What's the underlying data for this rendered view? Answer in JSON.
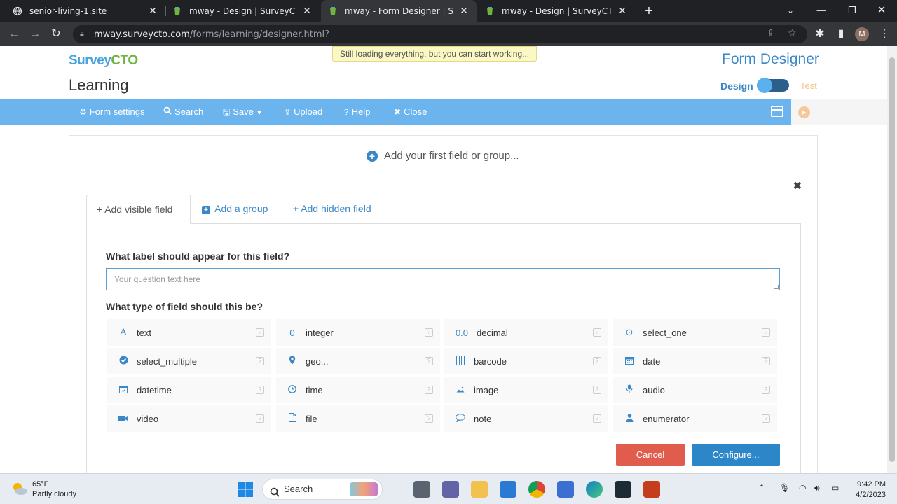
{
  "browser": {
    "tabs": [
      {
        "title": "senior-living-1.site",
        "active": false
      },
      {
        "title": "mway - Design | SurveyCTO",
        "active": false
      },
      {
        "title": "mway - Form Designer | SurveyC",
        "active": true
      },
      {
        "title": "mway - Design | SurveyCTO",
        "active": false
      }
    ],
    "url_host": "mway.surveycto.com",
    "url_path": "/forms/learning/designer.html?",
    "profile_initial": "M"
  },
  "app": {
    "logo_survey": "Survey",
    "logo_cto": "CTO",
    "form_name": "Learning",
    "loading_notice": "Still loading everything, but you can start working...",
    "page_title": "Form Designer",
    "mode_design": "Design",
    "mode_test": "Test",
    "mode_design_active": true
  },
  "toolbar": {
    "form_settings": "Form settings",
    "search": "Search",
    "save": "Save",
    "upload": "Upload",
    "help": "Help",
    "close": "Close"
  },
  "editor": {
    "add_first": "Add your first field or group...",
    "tabs": {
      "visible": "Add visible field",
      "group": "Add a group",
      "hidden": "Add hidden field"
    },
    "label_question": "What label should appear for this field?",
    "label_placeholder": "Your question text here",
    "type_question": "What type of field should this be?",
    "field_types": [
      {
        "name": "text",
        "icon": "text-icon"
      },
      {
        "name": "integer",
        "icon": "integer-icon"
      },
      {
        "name": "decimal",
        "icon": "decimal-icon"
      },
      {
        "name": "select_one",
        "icon": "radio-icon"
      },
      {
        "name": "select_multiple",
        "icon": "check-circle-icon"
      },
      {
        "name": "geo...",
        "icon": "map-marker-icon"
      },
      {
        "name": "barcode",
        "icon": "barcode-icon"
      },
      {
        "name": "date",
        "icon": "calendar-icon"
      },
      {
        "name": "datetime",
        "icon": "calendar-clock-icon"
      },
      {
        "name": "time",
        "icon": "clock-icon"
      },
      {
        "name": "image",
        "icon": "image-icon"
      },
      {
        "name": "audio",
        "icon": "microphone-icon"
      },
      {
        "name": "video",
        "icon": "video-camera-icon"
      },
      {
        "name": "file",
        "icon": "file-icon"
      },
      {
        "name": "note",
        "icon": "speech-bubble-icon"
      },
      {
        "name": "enumerator",
        "icon": "user-icon"
      }
    ],
    "cancel": "Cancel",
    "configure": "Configure..."
  },
  "taskbar": {
    "temperature": "65°F",
    "weather": "Partly cloudy",
    "search": "Search",
    "time": "9:42 PM",
    "date": "4/2/2023"
  },
  "colors": {
    "toolbar": "#6cb4ed",
    "accent": "#3a87c8",
    "cancel": "#e05d4e",
    "configure": "#2d86c8"
  }
}
